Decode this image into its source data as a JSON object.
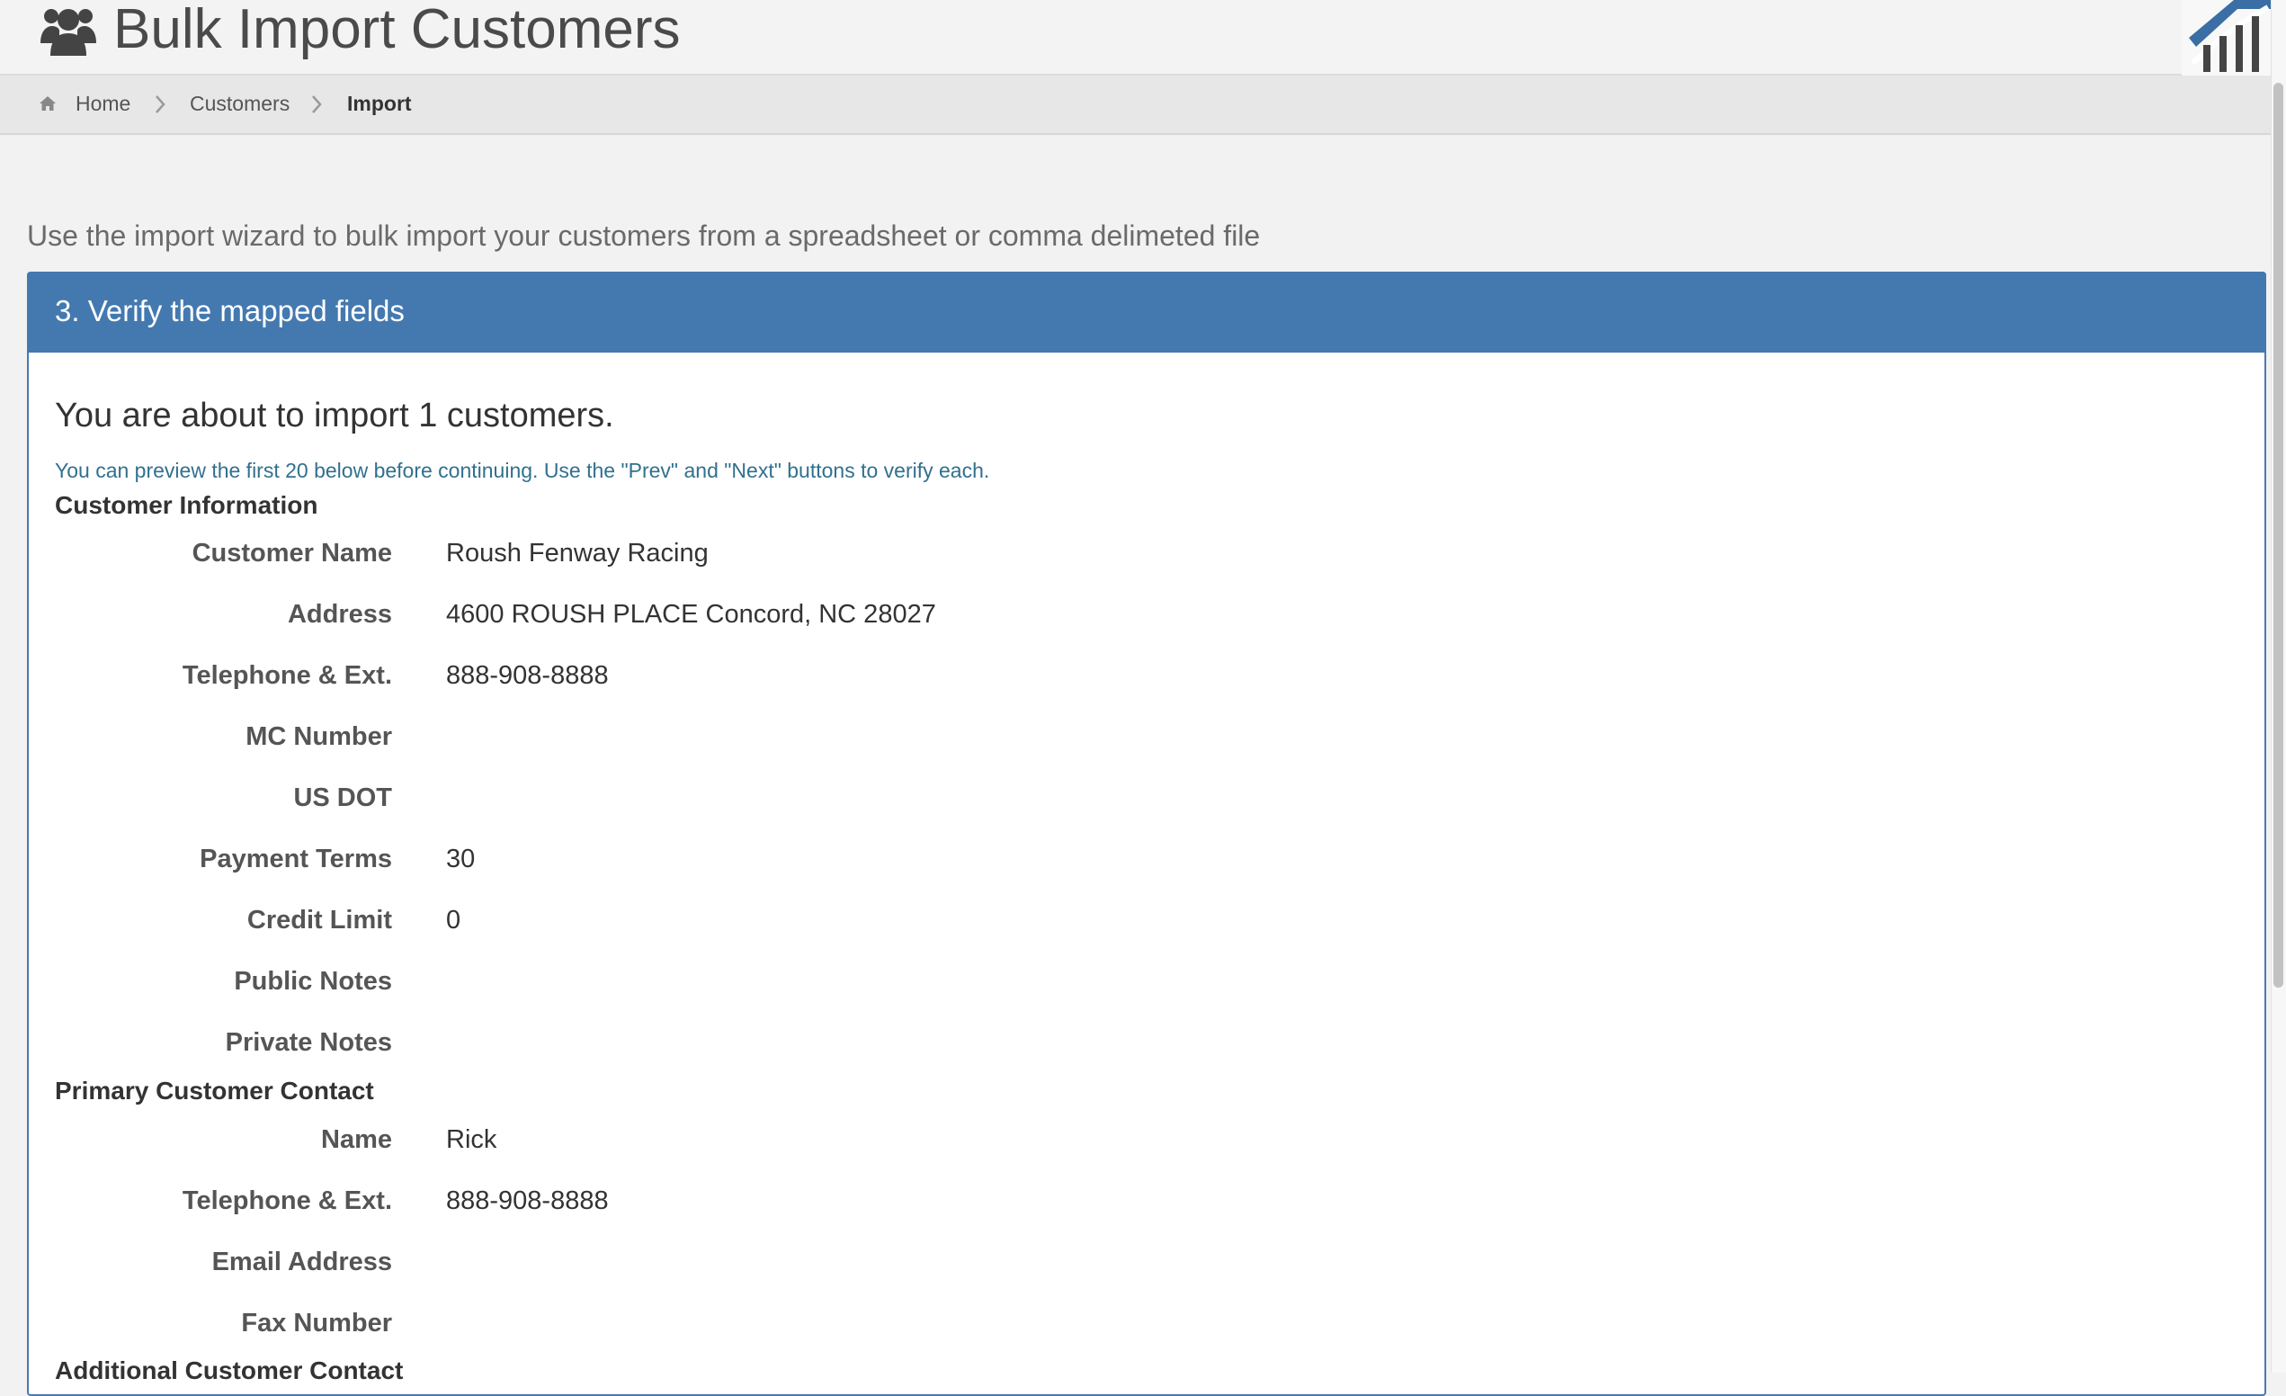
{
  "header": {
    "title": "Bulk Import Customers",
    "icon": "users-icon",
    "logo": "chart-logo"
  },
  "breadcrumb": {
    "home": "Home",
    "customers": "Customers",
    "current": "Import"
  },
  "intro": "Use the import wizard to bulk import your customers from a spreadsheet or comma delimeted file",
  "panel": {
    "title": "3. Verify the mapped fields",
    "about": "You are about to import 1 customers.",
    "preview_note": "You can preview the first 20 below before continuing. Use the \"Prev\" and \"Next\" buttons to verify each."
  },
  "customer_info": {
    "title": "Customer Information",
    "fields": [
      {
        "label": "Customer Name",
        "value": "Roush Fenway Racing"
      },
      {
        "label": "Address",
        "value": "4600 ROUSH PLACE Concord, NC 28027"
      },
      {
        "label": "Telephone & Ext.",
        "value": "888-908-8888"
      },
      {
        "label": "MC Number",
        "value": ""
      },
      {
        "label": "US DOT",
        "value": ""
      },
      {
        "label": "Payment Terms",
        "value": "30"
      },
      {
        "label": "Credit Limit",
        "value": "0"
      },
      {
        "label": "Public Notes",
        "value": ""
      },
      {
        "label": "Private Notes",
        "value": ""
      }
    ]
  },
  "primary_contact": {
    "title": "Primary Customer Contact",
    "fields": [
      {
        "label": "Name",
        "value": "Rick"
      },
      {
        "label": "Telephone & Ext.",
        "value": "888-908-8888"
      },
      {
        "label": "Email Address",
        "value": ""
      },
      {
        "label": "Fax Number",
        "value": ""
      }
    ]
  },
  "additional_contact": {
    "title": "Additional Customer Contact"
  },
  "colors": {
    "accent": "#4479b0",
    "note": "#31708f",
    "background": "#f2f2f2"
  }
}
